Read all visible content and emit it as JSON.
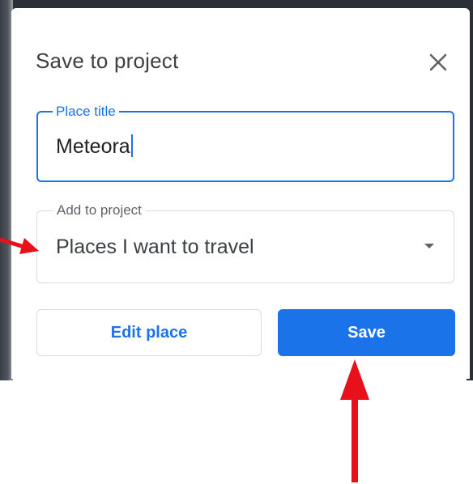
{
  "dialog": {
    "title": "Save to project",
    "close_icon": "close-icon"
  },
  "place_field": {
    "label": "Place title",
    "value": "Meteora",
    "state": "focused"
  },
  "project_field": {
    "label": "Add to project",
    "selected": "Places I want to travel",
    "icon": "chevron-down-icon"
  },
  "buttons": {
    "edit_label": "Edit place",
    "save_label": "Save"
  },
  "colors": {
    "accent": "#1a73e8",
    "title_text": "#3c4043",
    "border": "#dadce0",
    "annotation": "#e8101a"
  },
  "annotations": {
    "arrows": [
      "arrow-to-project-select",
      "arrow-to-save-button"
    ]
  }
}
